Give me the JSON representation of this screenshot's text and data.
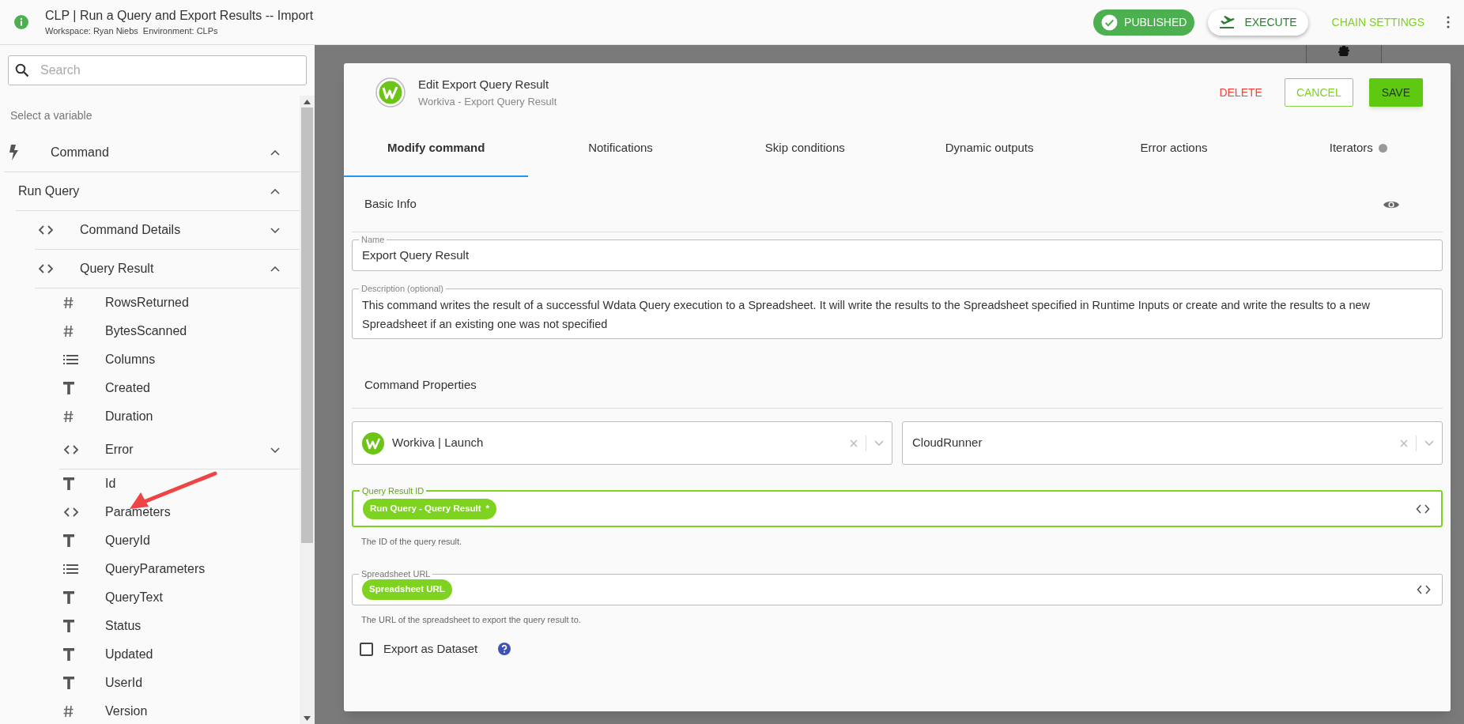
{
  "header": {
    "title": "CLP | Run a Query and Export Results -- Import",
    "workspace": "Workspace: Ryan Niebs",
    "environment": "Environment: CLPs",
    "status": "PUBLISHED",
    "execute": "EXECUTE",
    "chain_settings": "CHAIN SETTINGS"
  },
  "sidebar": {
    "search": {
      "placeholder": "Search"
    },
    "hint": "Select a variable",
    "tree": [
      {
        "label": "Command",
        "kind": "bolt",
        "expanded": true,
        "children": [
          {
            "label": "Run Query",
            "kind": "plain",
            "expanded": true,
            "children": [
              {
                "label": "Command Details",
                "kind": "object",
                "expanded": false
              },
              {
                "label": "Query Result",
                "kind": "object",
                "expanded": true,
                "children": [
                  {
                    "label": "RowsReturned",
                    "kind": "number"
                  },
                  {
                    "label": "BytesScanned",
                    "kind": "number"
                  },
                  {
                    "label": "Columns",
                    "kind": "list"
                  },
                  {
                    "label": "Created",
                    "kind": "text"
                  },
                  {
                    "label": "Duration",
                    "kind": "number"
                  },
                  {
                    "label": "Error",
                    "kind": "object",
                    "expanded": false
                  },
                  {
                    "label": "Id",
                    "kind": "text"
                  },
                  {
                    "label": "Parameters",
                    "kind": "object"
                  },
                  {
                    "label": "QueryId",
                    "kind": "text"
                  },
                  {
                    "label": "QueryParameters",
                    "kind": "list"
                  },
                  {
                    "label": "QueryText",
                    "kind": "text"
                  },
                  {
                    "label": "Status",
                    "kind": "text"
                  },
                  {
                    "label": "Updated",
                    "kind": "text"
                  },
                  {
                    "label": "UserId",
                    "kind": "text"
                  },
                  {
                    "label": "Version",
                    "kind": "number"
                  }
                ]
              }
            ]
          }
        ]
      }
    ]
  },
  "modal": {
    "title": "Edit Export Query Result",
    "subtitle": "Workiva - Export Query Result",
    "delete": "DELETE",
    "cancel": "CANCEL",
    "save": "SAVE",
    "tabs": [
      {
        "label": "Modify command",
        "selected": true,
        "dot": false
      },
      {
        "label": "Notifications",
        "selected": false,
        "dot": false
      },
      {
        "label": "Skip conditions",
        "selected": false,
        "dot": false
      },
      {
        "label": "Dynamic outputs",
        "selected": false,
        "dot": false
      },
      {
        "label": "Error actions",
        "selected": false,
        "dot": false
      },
      {
        "label": "Iterators",
        "selected": false,
        "dot": true
      }
    ],
    "basic_info": {
      "heading": "Basic Info",
      "name": {
        "label": "Name",
        "value": "Export Query Result"
      },
      "description": {
        "label": "Description (optional)",
        "value": "This command writes the result of a successful Wdata Query execution to a Spreadsheet. It will write the results to the Spreadsheet specified in Runtime Inputs or create and write the results to a new Spreadsheet if an existing one was not specified"
      }
    },
    "command_properties": {
      "heading": "Command Properties",
      "selects": [
        {
          "value": "Workiva | Launch",
          "logo": true
        },
        {
          "value": "CloudRunner",
          "logo": false
        }
      ],
      "fields": [
        {
          "label": "Query Result ID",
          "focused": true,
          "chip": "Run Query - Query Result",
          "required_mark": "*",
          "helper": "The ID of the query result."
        },
        {
          "label": "Spreadsheet URL",
          "focused": false,
          "chip": "Spreadsheet URL",
          "helper": "The URL of the spreadsheet to export the query result to."
        }
      ],
      "export_dataset": {
        "label": "Export as Dataset",
        "checked": false
      }
    }
  }
}
